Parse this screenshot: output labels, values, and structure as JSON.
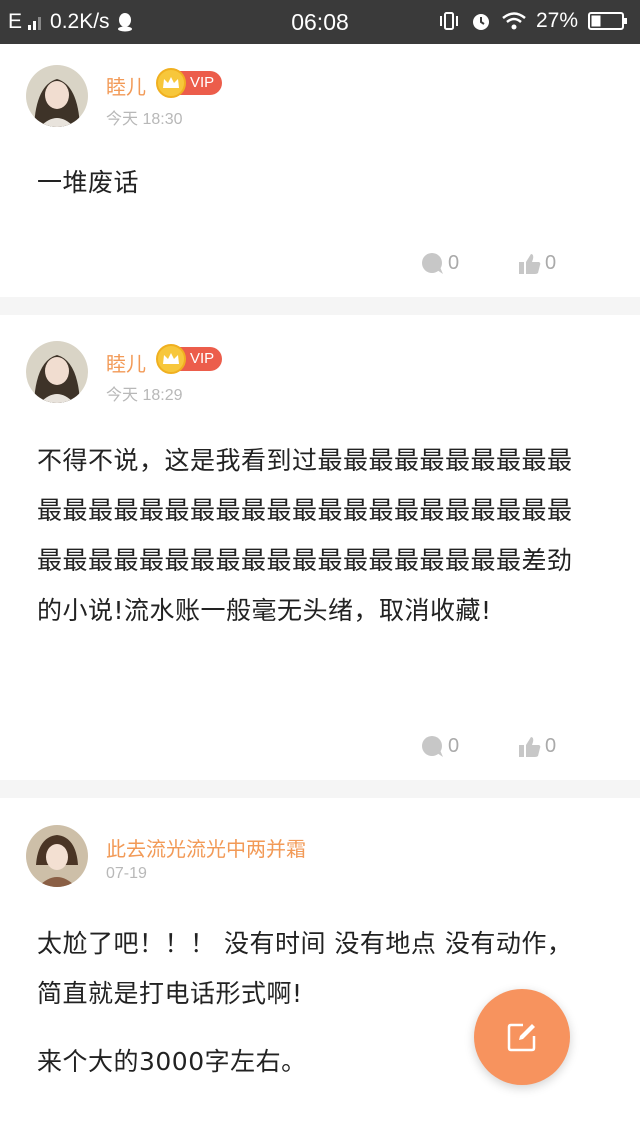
{
  "status_bar": {
    "carrier": "E",
    "speed": "0.2K/s",
    "time": "06:08",
    "battery": "27%"
  },
  "comments": [
    {
      "username": "睦儿",
      "vip_label": "VIP",
      "time": "今天 18:30",
      "paragraphs": [
        "一堆废话"
      ],
      "reply_count": "0",
      "like_count": "0",
      "avatar_icon": "avatar-girl-1"
    },
    {
      "username": "睦儿",
      "vip_label": "VIP",
      "time": "今天 18:29",
      "paragraphs": [
        "不得不说，这是我看到过最最最最最最最最最最最最最最最最最最最最最最最最最最最最最最最最最最最最最最最最最最最最最最最最最最差劲的小说!流水账一般毫无头绪，取消收藏!"
      ],
      "reply_count": "0",
      "like_count": "0",
      "avatar_icon": "avatar-girl-1"
    },
    {
      "username": "此去流光流光中两并霜",
      "time": "07-19",
      "paragraphs": [
        "太尬了吧！！！ 没有时间 没有地点 没有动作，简直就是打电话形式啊!",
        "来个大的3000字左右。"
      ],
      "avatar_icon": "avatar-girl-2"
    }
  ],
  "fab_icon": "edit-icon",
  "colors": {
    "username": "#f29a57",
    "vip_badge": "#ec5d4b",
    "crown": "#f7c73b",
    "fab": "#f7935e",
    "status_bar": "#3a3a3a"
  }
}
